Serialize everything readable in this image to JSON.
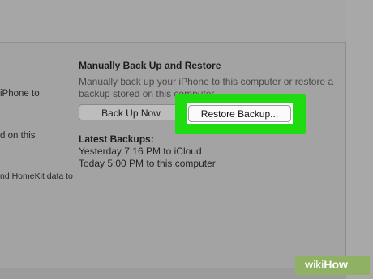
{
  "left_fragments": {
    "line1": "iPhone to",
    "line2": "d on this",
    "line3": "nd HomeKit data to"
  },
  "manual_backup": {
    "title": "Manually Back Up and Restore",
    "description": "Manually back up your iPhone to this computer or restore a backup stored on this computer.",
    "back_up_now_label": "Back Up Now",
    "restore_backup_label": "Restore Backup..."
  },
  "latest_backups": {
    "title": "Latest Backups:",
    "entries": [
      "Yesterday 7:16 PM to iCloud",
      "Today 5:00 PM to this computer"
    ]
  },
  "watermark": {
    "prefix": "wiki",
    "suffix": "How"
  },
  "colors": {
    "highlight": "#1fdc12",
    "watermark_bg": "#8fb163"
  }
}
